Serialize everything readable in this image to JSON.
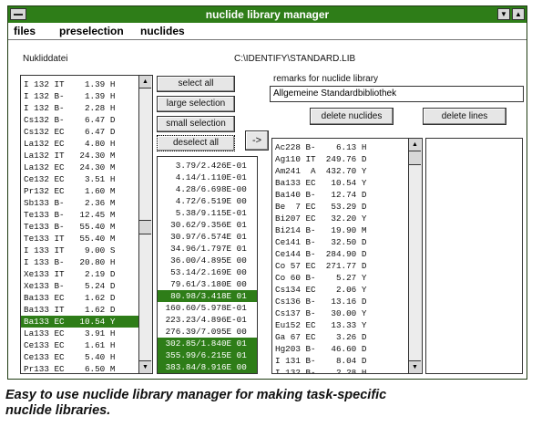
{
  "window": {
    "title": "nuclide library manager"
  },
  "menu": [
    "files",
    "preselection",
    "nuclides"
  ],
  "nukliddatei_label": "Nukliddatei",
  "library_path": "C:\\IDENTIFY\\STANDARD.LIB",
  "remarks_label": "remarks for nuclide library",
  "remarks_value": "Allgemeine Standardbibliothek",
  "buttons": {
    "select_all": "select all",
    "large_selection": "large selection",
    "small_selection": "small selection",
    "deselect_all": "deselect all",
    "transfer": "->",
    "delete_nuclides": "delete nuclides",
    "delete_lines": "delete lines"
  },
  "nuclide_list": [
    {
      "text": "I 132 IT    1.39 H",
      "selected": false
    },
    {
      "text": "I 132 B-    1.39 H",
      "selected": false
    },
    {
      "text": "I 132 B-    2.28 H",
      "selected": false
    },
    {
      "text": "Cs132 B-    6.47 D",
      "selected": false
    },
    {
      "text": "Cs132 EC    6.47 D",
      "selected": false
    },
    {
      "text": "La132 EC    4.80 H",
      "selected": false
    },
    {
      "text": "La132 IT   24.30 M",
      "selected": false
    },
    {
      "text": "La132 EC   24.30 M",
      "selected": false
    },
    {
      "text": "Ce132 EC    3.51 H",
      "selected": false
    },
    {
      "text": "Pr132 EC    1.60 M",
      "selected": false
    },
    {
      "text": "Sb133 B-    2.36 M",
      "selected": false
    },
    {
      "text": "Te133 B-   12.45 M",
      "selected": false
    },
    {
      "text": "Te133 B-   55.40 M",
      "selected": false
    },
    {
      "text": "Te133 IT   55.40 M",
      "selected": false
    },
    {
      "text": "I 133 IT    9.00 S",
      "selected": false
    },
    {
      "text": "I 133 B-   20.80 H",
      "selected": false
    },
    {
      "text": "Xe133 IT    2.19 D",
      "selected": false
    },
    {
      "text": "Xe133 B-    5.24 D",
      "selected": false
    },
    {
      "text": "Ba133 EC    1.62 D",
      "selected": false
    },
    {
      "text": "Ba133 IT    1.62 D",
      "selected": false
    },
    {
      "text": "Ba133 EC   10.54 Y",
      "selected": true
    },
    {
      "text": "La133 EC    3.91 H",
      "selected": false
    },
    {
      "text": "Ce133 EC    1.61 H",
      "selected": false
    },
    {
      "text": "Ce133 EC    5.40 H",
      "selected": false
    },
    {
      "text": "Pr133 EC    6.50 M",
      "selected": false
    }
  ],
  "energy_list": [
    {
      "text": "   3.79/2.426E-01",
      "selected": false
    },
    {
      "text": "   4.14/1.110E-01",
      "selected": false
    },
    {
      "text": "   4.28/6.698E-00",
      "selected": false
    },
    {
      "text": "   4.72/6.519E 00",
      "selected": false
    },
    {
      "text": "   5.38/9.115E-01",
      "selected": false
    },
    {
      "text": "  30.62/9.356E 01",
      "selected": false
    },
    {
      "text": "  30.97/6.574E 01",
      "selected": false
    },
    {
      "text": "  34.96/1.797E 01",
      "selected": false
    },
    {
      "text": "  36.00/4.895E 00",
      "selected": false
    },
    {
      "text": "  53.14/2.169E 00",
      "selected": false
    },
    {
      "text": "  79.61/3.180E 00",
      "selected": false
    },
    {
      "text": "  80.98/3.418E 01",
      "selected": true
    },
    {
      "text": " 160.60/5.978E-01",
      "selected": false
    },
    {
      "text": " 223.23/4.896E-01",
      "selected": false
    },
    {
      "text": " 276.39/7.095E 00",
      "selected": false
    },
    {
      "text": " 302.85/1.840E 01",
      "selected": true
    },
    {
      "text": " 355.99/6.215E 01",
      "selected": true
    },
    {
      "text": " 383.84/8.916E 00",
      "selected": true
    }
  ],
  "library_list": [
    "Ac228 B-    6.13 H",
    "Ag110 IT  249.76 D",
    "Am241  A  432.70 Y",
    "Ba133 EC   10.54 Y",
    "Ba140 B-   12.74 D",
    "Be  7 EC   53.29 D",
    "Bi207 EC   32.20 Y",
    "Bi214 B-   19.90 M",
    "Ce141 B-   32.50 D",
    "Ce144 B-  284.90 D",
    "Co 57 EC  271.77 D",
    "Co 60 B-    5.27 Y",
    "Cs134 EC    2.06 Y",
    "Cs136 B-   13.16 D",
    "Cs137 B-   30.00 Y",
    "Eu152 EC   13.33 Y",
    "Ga 67 EC    3.26 D",
    "Hg203 B-   46.60 D",
    "I 131 B-    8.04 D",
    "I 132 B-    2.28 H"
  ],
  "caption": [
    "Easy to use nuclide library manager for making task-specific",
    "nuclide libraries."
  ],
  "colors": {
    "titlebar": "#2e7d18",
    "selection": "#2e7d18"
  },
  "icons": {
    "system_menu": "system-menu-icon",
    "minimize": "minimize-arrow-icon",
    "maximize": "maximize-arrow-icon",
    "scroll_up": "scroll-up-arrow-icon",
    "scroll_down": "scroll-down-arrow-icon"
  }
}
